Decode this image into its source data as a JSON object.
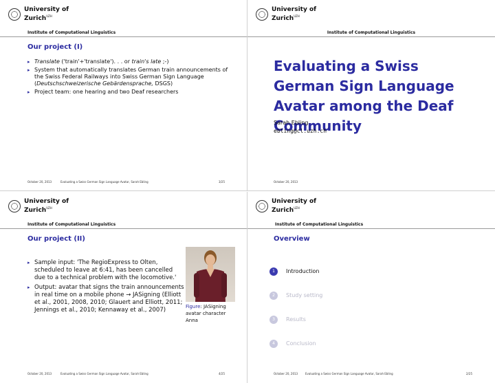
{
  "logo": {
    "line1": "University of",
    "line2": "Zurich",
    "sup": "UZH"
  },
  "institute": "Institute of Computational Linguistics",
  "footer": {
    "date": "October 20, 2013",
    "talk": "Evaluating a Swiss German Sign Language Avatar, Sarah Ebling"
  },
  "slides": {
    "s1": {
      "title": "Our project (I)",
      "b1_it1": "Translate",
      "b1_mid": " ('train'+'translate'). . . or ",
      "b1_it2": "train's late",
      "b1_end": " ;-)",
      "b2_pre": "System that automatically translates German train announcements of the Swiss Federal Railways into Swiss German Sign Language (",
      "b2_it": "Deutschschweizerische Gebärdensprache,",
      "b2_end": " DSGS)",
      "b3": "Project team: one hearing and two Deaf researchers",
      "page": "3/25"
    },
    "s2": {
      "title": "Evaluating a Swiss German Sign Language Avatar among the Deaf Community",
      "author": "Sarah Ebling",
      "email": "ebling@cl.uzh.ch"
    },
    "s3": {
      "title": "Our project (II)",
      "b1": "Sample input: 'The RegioExpress to Olten, scheduled to leave at 6:41, has been cancelled due to a technical problem with the locomotive.'",
      "b2": "Output: avatar that signs the train announcements in real time on a mobile phone → JASigning (Elliott et al., 2001, 2008, 2010; Glauert and Elliott, 2011; Jennings et al., 2010; Kennaway et al., 2007)",
      "caption_label": "Figure",
      "caption_text": ": JASigning avatar character Anna",
      "page": "4/25"
    },
    "s4": {
      "title": "Overview",
      "items": [
        {
          "num": "1",
          "label": "Introduction"
        },
        {
          "num": "2",
          "label": "Study setting"
        },
        {
          "num": "3",
          "label": "Results"
        },
        {
          "num": "4",
          "label": "Conclusion"
        }
      ],
      "page": "2/25"
    }
  }
}
